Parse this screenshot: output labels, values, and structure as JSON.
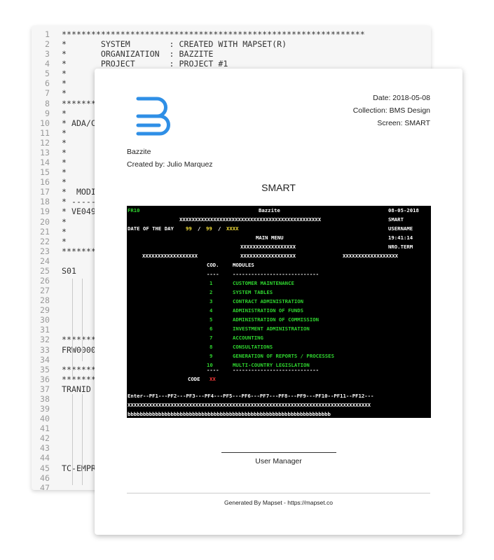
{
  "code": {
    "lines": [
      {
        "n": "1",
        "t": "**************************************************************"
      },
      {
        "n": "2",
        "t": "*       SYSTEM        : CREATED WITH MAPSET(R)"
      },
      {
        "n": "3",
        "t": "*       ORGANIZATION  : BAZZITE"
      },
      {
        "n": "4",
        "t": "*       PROJECT       : PROJECT #1"
      },
      {
        "n": "5",
        "t": "*"
      },
      {
        "n": "6",
        "t": "*"
      },
      {
        "n": "7",
        "t": "*"
      },
      {
        "n": "8",
        "t": "*******"
      },
      {
        "n": "9",
        "t": "*"
      },
      {
        "n": "10",
        "t": "* ADA/C"
      },
      {
        "n": "11",
        "t": "*"
      },
      {
        "n": "12",
        "t": "*"
      },
      {
        "n": "13",
        "t": "*"
      },
      {
        "n": "14",
        "t": "*"
      },
      {
        "n": "15",
        "t": "*"
      },
      {
        "n": "16",
        "t": "*"
      },
      {
        "n": "17",
        "t": "*  MODI"
      },
      {
        "n": "18",
        "t": "* -----"
      },
      {
        "n": "19",
        "t": "* VE049"
      },
      {
        "n": "20",
        "t": "*"
      },
      {
        "n": "21",
        "t": "*"
      },
      {
        "n": "22",
        "t": "*"
      },
      {
        "n": "23",
        "t": "*******"
      },
      {
        "n": "24",
        "t": ""
      },
      {
        "n": "25",
        "t": "S01"
      },
      {
        "n": "26",
        "t": ""
      },
      {
        "n": "27",
        "t": ""
      },
      {
        "n": "28",
        "t": ""
      },
      {
        "n": "29",
        "t": ""
      },
      {
        "n": "30",
        "t": ""
      },
      {
        "n": "31",
        "t": ""
      },
      {
        "n": "32",
        "t": "*******"
      },
      {
        "n": "33",
        "t": "FRW0000"
      },
      {
        "n": "34",
        "t": ""
      },
      {
        "n": "35",
        "t": "*******"
      },
      {
        "n": "36",
        "t": "*******"
      },
      {
        "n": "37",
        "t": "TRANID"
      },
      {
        "n": "38",
        "t": ""
      },
      {
        "n": "39",
        "t": ""
      },
      {
        "n": "40",
        "t": ""
      },
      {
        "n": "41",
        "t": ""
      },
      {
        "n": "42",
        "t": ""
      },
      {
        "n": "43",
        "t": ""
      },
      {
        "n": "44",
        "t": ""
      },
      {
        "n": "45",
        "t": "TC-EMPR"
      },
      {
        "n": "46",
        "t": ""
      },
      {
        "n": "47",
        "t": ""
      }
    ]
  },
  "doc": {
    "date": "Date: 2018-05-08",
    "collection": "Collection: BMS Design",
    "screen": "Screen: SMART",
    "org": "Bazzite",
    "created_by": "Created by: Julio Marquez",
    "title": "SMART",
    "signature_label": "User Manager",
    "footer": "Generated By Mapset - https://mapset.co",
    "logo_color": "#2f8fe6"
  },
  "terminal": {
    "colors": {
      "background": "#000000",
      "green": "#2fd42f",
      "yellow": "#f2de3a",
      "red": "#ff3b3b",
      "white": "#ffffff"
    },
    "fr": "FR10",
    "org": "Bazzite",
    "date": "08-05-2018",
    "xline1": "XXXXXXXXXXXXXXXXXXXXXXXXXXXXXXXXXXXXXXXXXXXXXX",
    "smart": "SMART",
    "date_label": "DATE OF THE DAY",
    "d1": "99",
    "slash1": "/",
    "d2": "99",
    "slash2": "/",
    "d3": "XXXX",
    "username": "USERNAME",
    "main_menu": "MAIN MENU",
    "time": "19:41:14",
    "xmenu": "XXXXXXXXXXXXXXXXXX",
    "nro_term": "NRO.TERM",
    "xleft": "XXXXXXXXXXXXXXXXXX",
    "xmid": "XXXXXXXXXXXXXXXXXX",
    "xright": "XXXXXXXXXXXXXXXXXX",
    "cod_header": "COD.",
    "modules_header": "MODULES",
    "dash_short": "----",
    "dash_long": "----------------------------",
    "menu": [
      {
        "code": "1",
        "label": "CUSTOMER MAINTENANCE"
      },
      {
        "code": "2",
        "label": "SYSTEM TABLES"
      },
      {
        "code": "3",
        "label": "CONTRACT ADMINISTRATION"
      },
      {
        "code": "4",
        "label": "ADMINISTRATION OF FUNDS"
      },
      {
        "code": "5",
        "label": "ADMINISTRATION OF COMMISSION"
      },
      {
        "code": "6",
        "label": "INVESTMENT ADMINISTRATION"
      },
      {
        "code": "7",
        "label": "ACCOUNTING"
      },
      {
        "code": "8",
        "label": "CONSULTATIONS"
      },
      {
        "code": "9",
        "label": "GENERATION OF REPORTS / PROCESSES"
      },
      {
        "code": "10",
        "label": "MULTI-COUNTRY LEGISLATION"
      }
    ],
    "code_label": "CODE",
    "code_value": "XX",
    "pf_line": "Enter--PF1---PF2---PF3---PF4---PF5---PF6---PF7---PF8---PF9---PF10--PF11--PF12---",
    "xfull": "XXXXXXXXXXXXXXXXXXXXXXXXXXXXXXXXXXXXXXXXXXXXXXXXXXXXXXXXXXXXXXXXXXXXXXXXXXXXXXX",
    "bline": "bbbbbbbbbbbbbbbbbbbbbbbbbbbbbbbbbbbbbbbbbbbbbbbbbbbbbbbbbbbbbbbbbb"
  }
}
